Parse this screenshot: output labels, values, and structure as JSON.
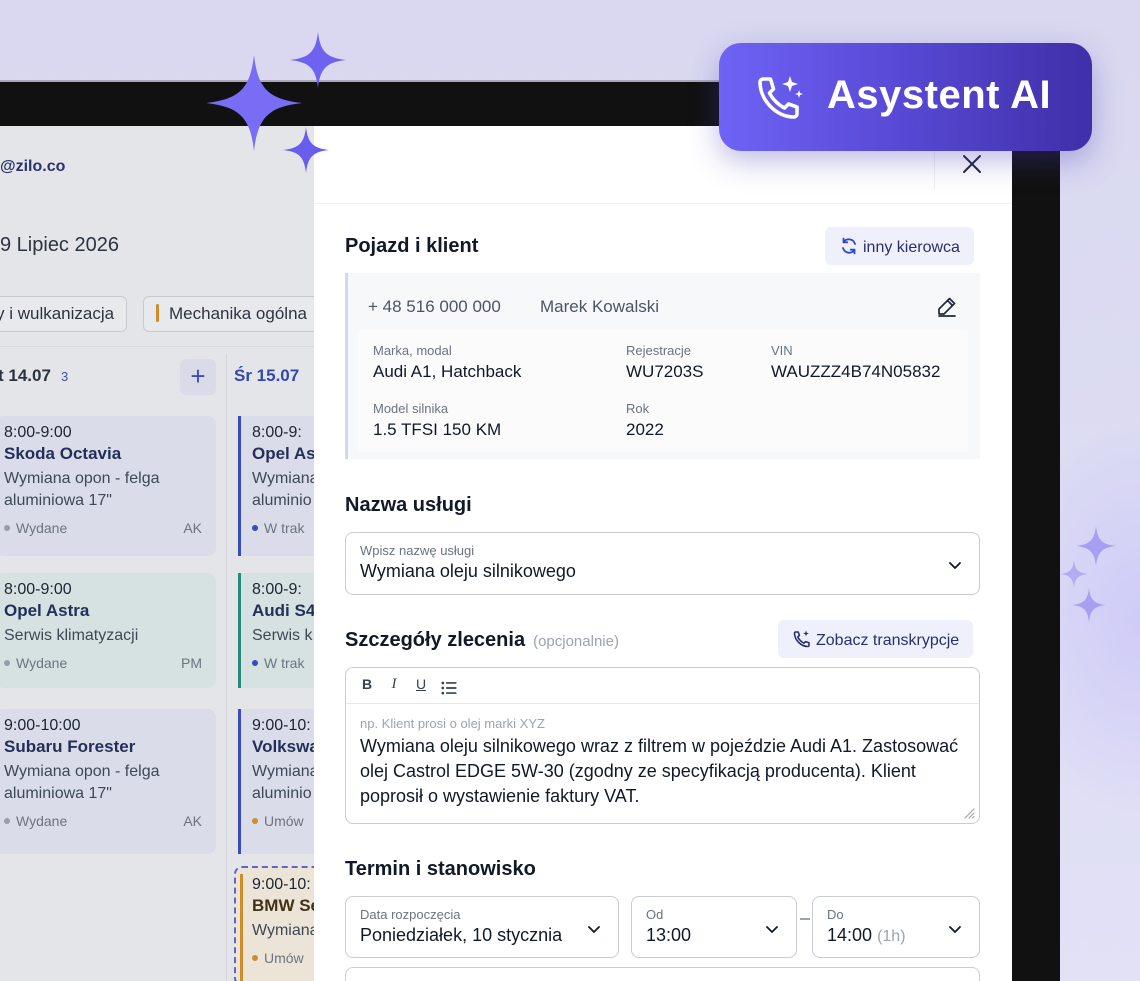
{
  "badge": {
    "label": "Asystent AI"
  },
  "calendar": {
    "email": "@zilo.co",
    "date": "9 Lipiec 2026",
    "chips": [
      {
        "label": "y i wulkanizacja"
      },
      {
        "label": "Mechanika ogólna"
      }
    ],
    "columns": [
      {
        "label": "t 14.07",
        "count": "3"
      },
      {
        "label": "Śr 15.07"
      }
    ],
    "col1_cards": [
      {
        "time": "8:00-9:00",
        "name": "Skoda Octavia",
        "desc": "Wymiana opon - felga aluminiowa 17\"",
        "status": "Wydane",
        "initials": "AK"
      },
      {
        "time": "8:00-9:00",
        "name": "Opel Astra",
        "desc": "Serwis klimatyzacji",
        "status": "Wydane",
        "initials": "PM"
      },
      {
        "time": "9:00-10:00",
        "name": "Subaru Forester",
        "desc": "Wymiana opon - felga aluminiowa 17\"",
        "status": "Wydane",
        "initials": "AK"
      }
    ],
    "col2_cards": [
      {
        "time": "8:00-9:",
        "name": "Opel As",
        "desc": "Wymiana aluminio",
        "status": "W trak"
      },
      {
        "time": "8:00-9:",
        "name": "Audi S4",
        "desc": "Serwis k",
        "status": "W trak"
      },
      {
        "time": "9:00-10:",
        "name": "Volkswa",
        "desc": "Wymiana aluminio",
        "status": "Umów"
      },
      {
        "time": "9:00-10:",
        "name": "BMW Se",
        "desc": "Wymiana",
        "status": "Umów"
      }
    ]
  },
  "panel": {
    "vehicle_section": {
      "title": "Pojazd i klient",
      "other_driver_label": "inny kierowca",
      "phone": "+ 48 516 000 000",
      "client_name": "Marek Kowalski",
      "fields": {
        "brand_label": "Marka, modal",
        "brand_value": "Audi A1, Hatchback",
        "reg_label": "Rejestracje",
        "reg_value": "WU7203S",
        "vin_label": "VIN",
        "vin_value": "WAUZZZ4B74N05832",
        "engine_label": "Model silnika",
        "engine_value": "1.5 TFSI 150 KM",
        "year_label": "Rok",
        "year_value": "2022"
      }
    },
    "service_section": {
      "title": "Nazwa usługi",
      "field_label": "Wpisz nazwę usługi",
      "field_value": "Wymiana oleju silnikowego"
    },
    "details_section": {
      "title": "Szczegóły zlecenia",
      "optional": "(opcjonalnie)",
      "transcript_label": "Zobacz transkrypcje",
      "toolbar": {
        "bold": "B",
        "italic": "I",
        "underline": "U"
      },
      "placeholder": "np. Klient prosi o olej marki XYZ",
      "text": "Wymiana oleju silnikowego wraz z filtrem w pojeździe Audi A1. Zastosować olej Castrol EDGE 5W-30 (zgodny ze specyfikacją producenta). Klient poprosił o wystawienie faktury VAT."
    },
    "schedule_section": {
      "title": "Termin i stanowisko",
      "start_label": "Data rozpoczęcia",
      "start_value": "Poniedziałek, 10 stycznia",
      "from_label": "Od",
      "from_value": "13:00",
      "to_label": "Do",
      "to_value": "14:00",
      "to_duration": "(1h)"
    }
  },
  "colors": {
    "accent": "#5a4bd8",
    "badge_start": "#6e63f5",
    "badge_end": "#3f2fa8",
    "status_blue": "#2f46c8",
    "status_teal": "#1c8a7a",
    "status_amber": "#d9911e"
  }
}
